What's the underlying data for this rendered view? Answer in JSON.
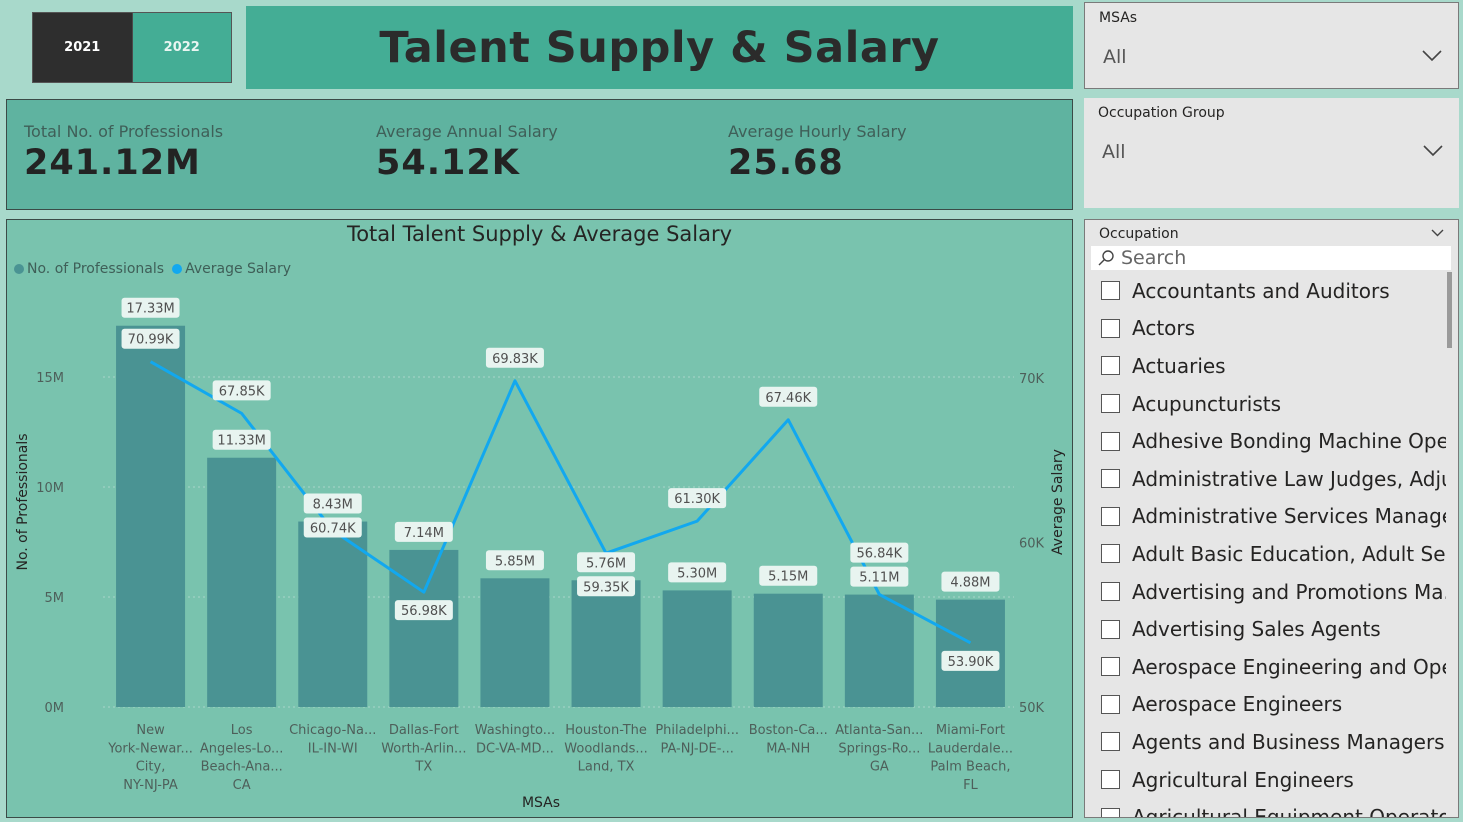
{
  "year_slicer": {
    "years": [
      "2021",
      "2022"
    ],
    "selected": "2021"
  },
  "title": "Talent Supply & Salary",
  "kpis": [
    {
      "label": "Total No. of Professionals",
      "value": "241.12M"
    },
    {
      "label": "Average Annual Salary",
      "value": "54.12K"
    },
    {
      "label": "Average Hourly Salary",
      "value": "25.68"
    }
  ],
  "slicers": {
    "msas": {
      "title": "MSAs",
      "value": "All"
    },
    "occupation_group": {
      "title": "Occupation Group",
      "value": "All"
    },
    "occupation": {
      "title": "Occupation",
      "search_placeholder": "Search",
      "items": [
        "Accountants and Auditors",
        "Actors",
        "Actuaries",
        "Acupuncturists",
        "Adhesive Bonding Machine Ope...",
        "Administrative Law Judges, Adju...",
        "Administrative Services Managers",
        "Adult Basic Education, Adult Sec...",
        "Advertising and Promotions Ma...",
        "Advertising Sales Agents",
        "Aerospace Engineering and Ope...",
        "Aerospace Engineers",
        "Agents and Business Managers ...",
        "Agricultural Engineers",
        "Agricultural Equipment Operators"
      ]
    }
  },
  "chart_data": {
    "type": "bar",
    "title": "Total Talent Supply & Average Salary",
    "xlabel": "MSAs",
    "ylabel": "No. of Professionals",
    "y2label": "Average Salary",
    "legend": [
      "No. of Professionals",
      "Average Salary"
    ],
    "legend_position": "top-left",
    "categories": [
      [
        "New",
        "York-Newar...",
        "City,",
        "NY-NJ-PA"
      ],
      [
        "Los",
        "Angeles-Lo...",
        "Beach-Ana...",
        "CA"
      ],
      [
        "Chicago-Na...",
        "IL-IN-WI"
      ],
      [
        "Dallas-Fort",
        "Worth-Arlin...",
        "TX"
      ],
      [
        "Washingto...",
        "DC-VA-MD..."
      ],
      [
        "Houston-The",
        "Woodlands...",
        "Land, TX"
      ],
      [
        "Philadelphi...",
        "PA-NJ-DE-..."
      ],
      [
        "Boston-Ca...",
        "MA-NH"
      ],
      [
        "Atlanta-San...",
        "Springs-Ro...",
        "GA"
      ],
      [
        "Miami-Fort",
        "Lauderdale...",
        "Palm Beach,",
        "FL"
      ]
    ],
    "series": [
      {
        "name": "No. of Professionals",
        "type": "bar",
        "color": "#4a9393",
        "values": [
          17.33,
          11.33,
          8.43,
          7.14,
          5.85,
          5.76,
          5.3,
          5.15,
          5.11,
          4.88
        ],
        "labels": [
          "17.33M",
          "11.33M",
          "8.43M",
          "7.14M",
          "5.85M",
          "5.76M",
          "5.30M",
          "5.15M",
          "5.11M",
          "4.88M"
        ]
      },
      {
        "name": "Average Salary",
        "type": "line",
        "color": "#12a8ef",
        "values": [
          70.99,
          67.85,
          60.74,
          56.98,
          69.83,
          59.35,
          61.3,
          67.46,
          56.84,
          53.9
        ],
        "labels": [
          "70.99K",
          "67.85K",
          "60.74K",
          "56.98K",
          "69.83K",
          "59.35K",
          "61.30K",
          "67.46K",
          "56.84K",
          "53.90K"
        ]
      }
    ],
    "y_ticks": [
      "0M",
      "5M",
      "10M",
      "15M"
    ],
    "y_tick_values": [
      0,
      5,
      10,
      15
    ],
    "y2_ticks": [
      "50K",
      "60K",
      "70K"
    ],
    "y2_tick_values": [
      50,
      60,
      70
    ],
    "ylim": [
      0,
      17.33
    ],
    "y2lim": [
      50,
      70.99
    ],
    "grid": true
  }
}
